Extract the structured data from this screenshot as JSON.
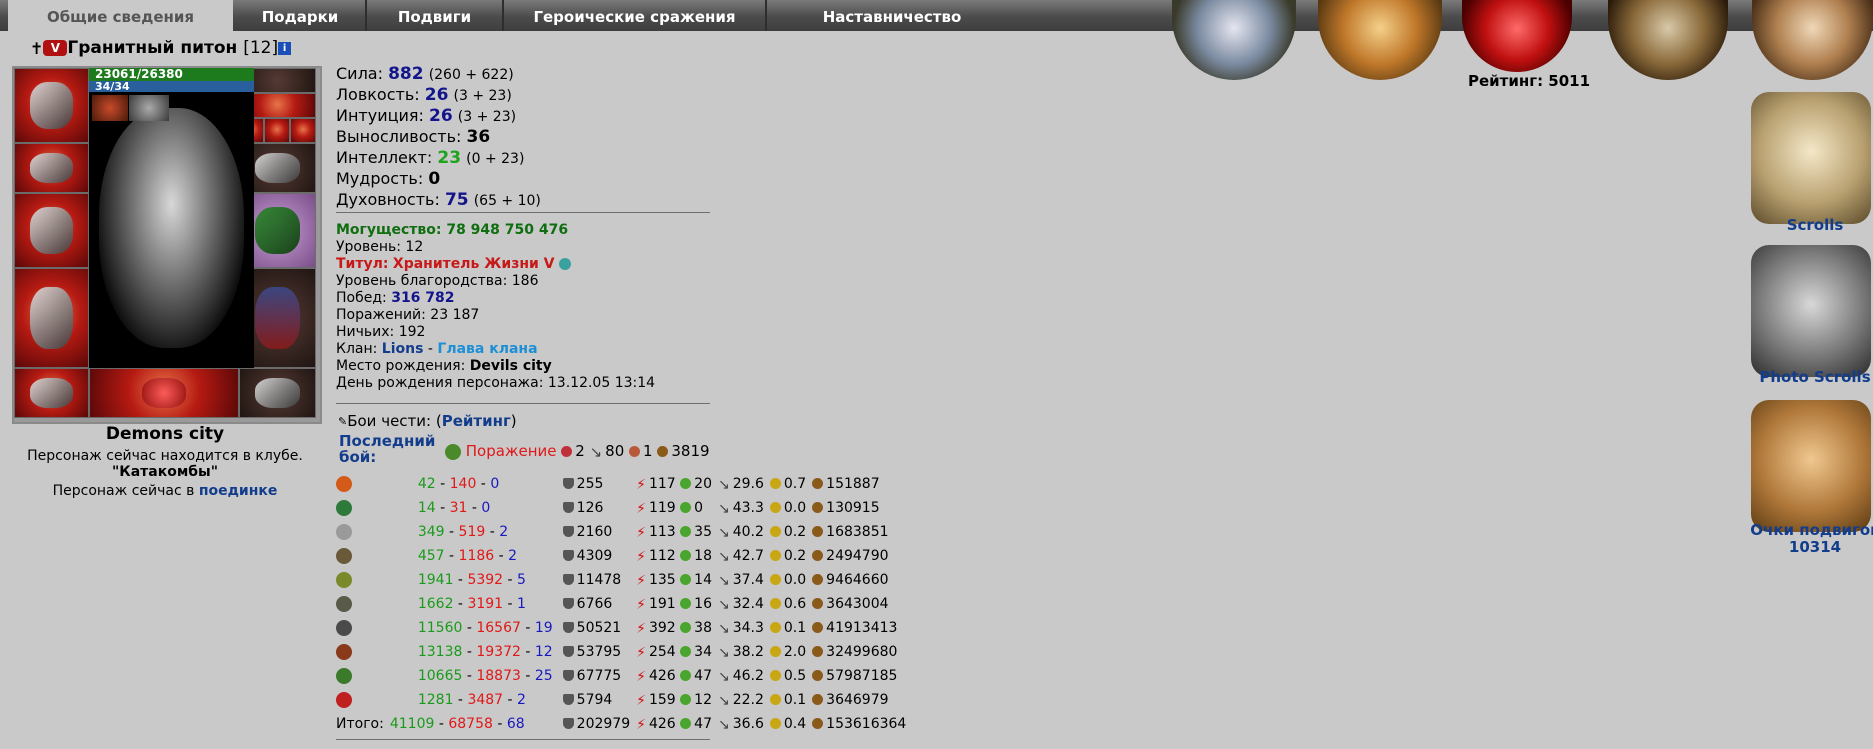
{
  "tabs": [
    "Общие сведения",
    "Подарки",
    "Подвиги",
    "Героические сражения",
    "Наставничество"
  ],
  "character": {
    "name": "Гранитный питон",
    "level": "[12]",
    "hp": "23061/26380",
    "mp": "34/34",
    "city": "Demons city",
    "location_text": "Персонаж сейчас находится в клубе.",
    "club_name": "\"Катакомбы\"",
    "fight_text": "Персонаж сейчас в",
    "fight_link": "поединке"
  },
  "stats": [
    {
      "label": "Сила:",
      "value": "882",
      "extra": "(260 + 622)",
      "color": "#13158a"
    },
    {
      "label": "Ловкость:",
      "value": "26",
      "extra": "(3 + 23)",
      "color": "#13158a"
    },
    {
      "label": "Интуиция:",
      "value": "26",
      "extra": "(3 + 23)",
      "color": "#13158a"
    },
    {
      "label": "Выносливость:",
      "value": "36",
      "extra": "",
      "color": "#000000"
    },
    {
      "label": "Интеллект:",
      "value": "23",
      "extra": "(0 + 23)",
      "color": "#1da31d"
    },
    {
      "label": "Мудрость:",
      "value": "0",
      "extra": "",
      "color": "#000000"
    },
    {
      "label": "Духовность:",
      "value": "75",
      "extra": "(65 + 10)",
      "color": "#13158a"
    }
  ],
  "info": {
    "might": "Могущество: 78 948 750 476",
    "level": "Уровень: 12",
    "title_label": "Титул:",
    "title_value": "Хранитель Жизни V",
    "nobility": "Уровень благородства: 186",
    "wins_label": "Побед:",
    "wins_value": "316 782",
    "losses": "Поражений: 23 187",
    "draws": "Ничьих: 192",
    "clan_label": "Клан:",
    "clan_name": "Lions",
    "clan_sep": "-",
    "clan_role": "Глава клана",
    "birthplace_label": "Место рождения:",
    "birthplace_value": "Devils city",
    "birthday": "День рождения персонажа: 13.12.05 13:14"
  },
  "honor": {
    "label": "Бои чести: (",
    "link": "Рейтинг",
    "close": ")",
    "last_fight_label": "Последний бой:",
    "last_result": "Поражение",
    "last_a": "2",
    "last_b": "80",
    "last_c": "1",
    "last_d": "3819"
  },
  "battles": [
    {
      "w": "42",
      "l": "140",
      "d": "0",
      "sh": "255",
      "bolt": "117",
      "plus": "20",
      "sw": "29.6",
      "coin": "0.7",
      "bag": "151887",
      "color": "#d45a1a"
    },
    {
      "w": "14",
      "l": "31",
      "d": "0",
      "sh": "126",
      "bolt": "119",
      "plus": "0",
      "sw": "43.3",
      "coin": "0.0",
      "bag": "130915",
      "color": "#2d7a3a"
    },
    {
      "w": "349",
      "l": "519",
      "d": "2",
      "sh": "2160",
      "bolt": "113",
      "plus": "35",
      "sw": "40.2",
      "coin": "0.2",
      "bag": "1683851",
      "color": "#9a9a9a"
    },
    {
      "w": "457",
      "l": "1186",
      "d": "2",
      "sh": "4309",
      "bolt": "112",
      "plus": "18",
      "sw": "42.7",
      "coin": "0.2",
      "bag": "2494790",
      "color": "#6b5a3a"
    },
    {
      "w": "1941",
      "l": "5392",
      "d": "5",
      "sh": "11478",
      "bolt": "135",
      "plus": "14",
      "sw": "37.4",
      "coin": "0.0",
      "bag": "9464660",
      "color": "#7a8a2a"
    },
    {
      "w": "1662",
      "l": "3191",
      "d": "1",
      "sh": "6766",
      "bolt": "191",
      "plus": "16",
      "sw": "32.4",
      "coin": "0.6",
      "bag": "3643004",
      "color": "#5a5a4a"
    },
    {
      "w": "11560",
      "l": "16567",
      "d": "19",
      "sh": "50521",
      "bolt": "392",
      "plus": "38",
      "sw": "34.3",
      "coin": "0.1",
      "bag": "41913413",
      "color": "#4a4a4a"
    },
    {
      "w": "13138",
      "l": "19372",
      "d": "12",
      "sh": "53795",
      "bolt": "254",
      "plus": "34",
      "sw": "38.2",
      "coin": "2.0",
      "bag": "32499680",
      "color": "#8a3a1a"
    },
    {
      "w": "10665",
      "l": "18873",
      "d": "25",
      "sh": "67775",
      "bolt": "426",
      "plus": "47",
      "sw": "46.2",
      "coin": "0.5",
      "bag": "57987185",
      "color": "#3a7a2a"
    },
    {
      "w": "1281",
      "l": "3487",
      "d": "2",
      "sh": "5794",
      "bolt": "159",
      "plus": "12",
      "sw": "22.2",
      "coin": "0.1",
      "bag": "3646979",
      "color": "#c02020"
    }
  ],
  "totals": {
    "label": "Итого:",
    "w": "41109",
    "l": "68758",
    "d": "68",
    "sh": "202979",
    "bolt": "426",
    "plus": "47",
    "sw": "36.6",
    "coin": "0.4",
    "bag": "153616364"
  },
  "right": {
    "rating": "Рейтинг: 5011",
    "scrolls": "Scrolls",
    "photo_scrolls": "Photo Scrolls",
    "feats_label": "Очки подвигов",
    "feats_value": "10314"
  }
}
